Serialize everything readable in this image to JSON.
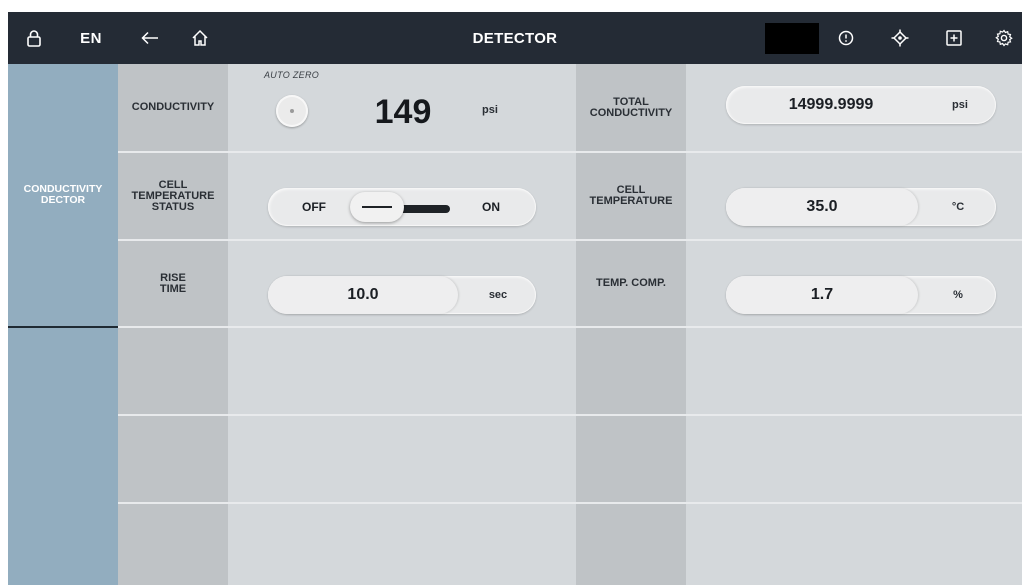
{
  "topbar": {
    "language": "EN",
    "title": "DETECTOR",
    "icons": [
      "lock-icon",
      "back-arrow-icon",
      "home-icon",
      "alert-icon",
      "crosshair-icon",
      "add-icon",
      "gear-icon"
    ]
  },
  "sidebar": {
    "active_category": "CONDUCTIVITY\nDECTOR"
  },
  "rows": [
    {
      "left_label": "CONDUCTIVITY",
      "auto_zero_label": "AUTO ZERO",
      "left_value": "149",
      "left_unit": "psi",
      "right_label": "TOTAL\nCONDUCTIVITY",
      "right_value": "14999.9999",
      "right_unit": "psi"
    },
    {
      "left_label": "CELL\nTEMPERATURE\nSTATUS",
      "toggle_off": "OFF",
      "toggle_on": "ON",
      "toggle_state": "off",
      "right_label": "CELL\nTEMPERATURE",
      "right_value": "35.0",
      "right_unit": "°C"
    },
    {
      "left_label": "RISE\nTIME",
      "left_value": "10.0",
      "left_unit": "sec",
      "right_label": "TEMP. COMP.",
      "right_value": "1.7",
      "right_unit": "%"
    }
  ],
  "colors": {
    "topbar": "#242b35",
    "sidebar": "#92adbf",
    "label_column": "#bfc3c6",
    "value_column": "#d4d8db"
  }
}
